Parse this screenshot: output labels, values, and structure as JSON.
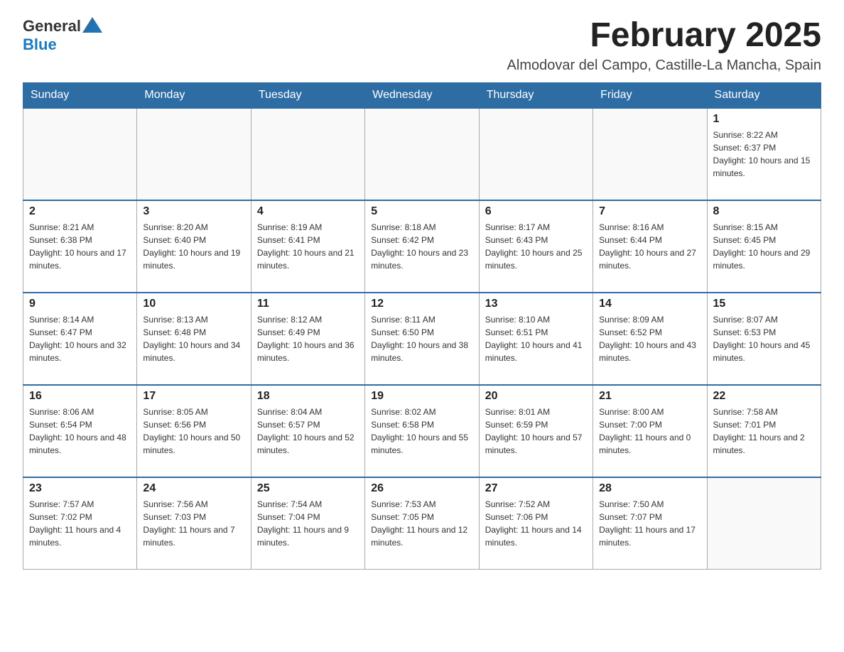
{
  "header": {
    "logo_general": "General",
    "logo_blue": "Blue",
    "month_title": "February 2025",
    "location": "Almodovar del Campo, Castille-La Mancha, Spain"
  },
  "days_of_week": [
    "Sunday",
    "Monday",
    "Tuesday",
    "Wednesday",
    "Thursday",
    "Friday",
    "Saturday"
  ],
  "weeks": [
    [
      {
        "day": "",
        "info": ""
      },
      {
        "day": "",
        "info": ""
      },
      {
        "day": "",
        "info": ""
      },
      {
        "day": "",
        "info": ""
      },
      {
        "day": "",
        "info": ""
      },
      {
        "day": "",
        "info": ""
      },
      {
        "day": "1",
        "info": "Sunrise: 8:22 AM\nSunset: 6:37 PM\nDaylight: 10 hours and 15 minutes."
      }
    ],
    [
      {
        "day": "2",
        "info": "Sunrise: 8:21 AM\nSunset: 6:38 PM\nDaylight: 10 hours and 17 minutes."
      },
      {
        "day": "3",
        "info": "Sunrise: 8:20 AM\nSunset: 6:40 PM\nDaylight: 10 hours and 19 minutes."
      },
      {
        "day": "4",
        "info": "Sunrise: 8:19 AM\nSunset: 6:41 PM\nDaylight: 10 hours and 21 minutes."
      },
      {
        "day": "5",
        "info": "Sunrise: 8:18 AM\nSunset: 6:42 PM\nDaylight: 10 hours and 23 minutes."
      },
      {
        "day": "6",
        "info": "Sunrise: 8:17 AM\nSunset: 6:43 PM\nDaylight: 10 hours and 25 minutes."
      },
      {
        "day": "7",
        "info": "Sunrise: 8:16 AM\nSunset: 6:44 PM\nDaylight: 10 hours and 27 minutes."
      },
      {
        "day": "8",
        "info": "Sunrise: 8:15 AM\nSunset: 6:45 PM\nDaylight: 10 hours and 29 minutes."
      }
    ],
    [
      {
        "day": "9",
        "info": "Sunrise: 8:14 AM\nSunset: 6:47 PM\nDaylight: 10 hours and 32 minutes."
      },
      {
        "day": "10",
        "info": "Sunrise: 8:13 AM\nSunset: 6:48 PM\nDaylight: 10 hours and 34 minutes."
      },
      {
        "day": "11",
        "info": "Sunrise: 8:12 AM\nSunset: 6:49 PM\nDaylight: 10 hours and 36 minutes."
      },
      {
        "day": "12",
        "info": "Sunrise: 8:11 AM\nSunset: 6:50 PM\nDaylight: 10 hours and 38 minutes."
      },
      {
        "day": "13",
        "info": "Sunrise: 8:10 AM\nSunset: 6:51 PM\nDaylight: 10 hours and 41 minutes."
      },
      {
        "day": "14",
        "info": "Sunrise: 8:09 AM\nSunset: 6:52 PM\nDaylight: 10 hours and 43 minutes."
      },
      {
        "day": "15",
        "info": "Sunrise: 8:07 AM\nSunset: 6:53 PM\nDaylight: 10 hours and 45 minutes."
      }
    ],
    [
      {
        "day": "16",
        "info": "Sunrise: 8:06 AM\nSunset: 6:54 PM\nDaylight: 10 hours and 48 minutes."
      },
      {
        "day": "17",
        "info": "Sunrise: 8:05 AM\nSunset: 6:56 PM\nDaylight: 10 hours and 50 minutes."
      },
      {
        "day": "18",
        "info": "Sunrise: 8:04 AM\nSunset: 6:57 PM\nDaylight: 10 hours and 52 minutes."
      },
      {
        "day": "19",
        "info": "Sunrise: 8:02 AM\nSunset: 6:58 PM\nDaylight: 10 hours and 55 minutes."
      },
      {
        "day": "20",
        "info": "Sunrise: 8:01 AM\nSunset: 6:59 PM\nDaylight: 10 hours and 57 minutes."
      },
      {
        "day": "21",
        "info": "Sunrise: 8:00 AM\nSunset: 7:00 PM\nDaylight: 11 hours and 0 minutes."
      },
      {
        "day": "22",
        "info": "Sunrise: 7:58 AM\nSunset: 7:01 PM\nDaylight: 11 hours and 2 minutes."
      }
    ],
    [
      {
        "day": "23",
        "info": "Sunrise: 7:57 AM\nSunset: 7:02 PM\nDaylight: 11 hours and 4 minutes."
      },
      {
        "day": "24",
        "info": "Sunrise: 7:56 AM\nSunset: 7:03 PM\nDaylight: 11 hours and 7 minutes."
      },
      {
        "day": "25",
        "info": "Sunrise: 7:54 AM\nSunset: 7:04 PM\nDaylight: 11 hours and 9 minutes."
      },
      {
        "day": "26",
        "info": "Sunrise: 7:53 AM\nSunset: 7:05 PM\nDaylight: 11 hours and 12 minutes."
      },
      {
        "day": "27",
        "info": "Sunrise: 7:52 AM\nSunset: 7:06 PM\nDaylight: 11 hours and 14 minutes."
      },
      {
        "day": "28",
        "info": "Sunrise: 7:50 AM\nSunset: 7:07 PM\nDaylight: 11 hours and 17 minutes."
      },
      {
        "day": "",
        "info": ""
      }
    ]
  ]
}
